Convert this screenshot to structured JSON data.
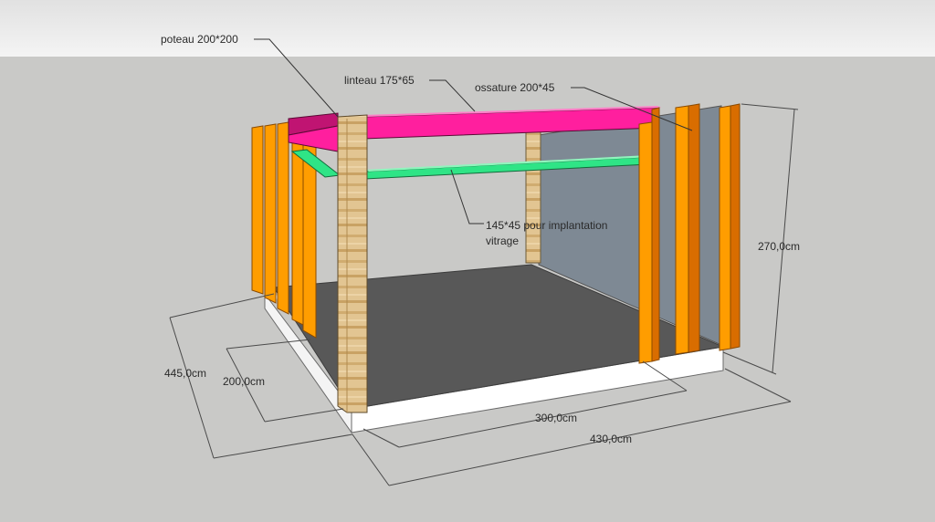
{
  "labels": {
    "poteau": "poteau 200*200",
    "linteau": "linteau 175*65",
    "ossature": "ossature 200*45",
    "traverse_line1": "145*45 pour implantation",
    "traverse_line2": "vitrage"
  },
  "dimensions": {
    "height": "270,0cm",
    "depth_total": "445,0cm",
    "depth_partial": "200,0cm",
    "width_partial": "300,0cm",
    "width_total": "430,0cm"
  },
  "colors": {
    "sky": "#ebebeb",
    "ground": "#c9c9c7",
    "floor": "#585858",
    "slab": "#ffffff",
    "back_wall": "#7e8994",
    "stud": "#ff9d00",
    "stud_dark": "#d96d00",
    "lintel": "#ff1f9e",
    "rail": "#2fe486",
    "post": "#e3c693",
    "dim_line": "#4a4a4a"
  }
}
